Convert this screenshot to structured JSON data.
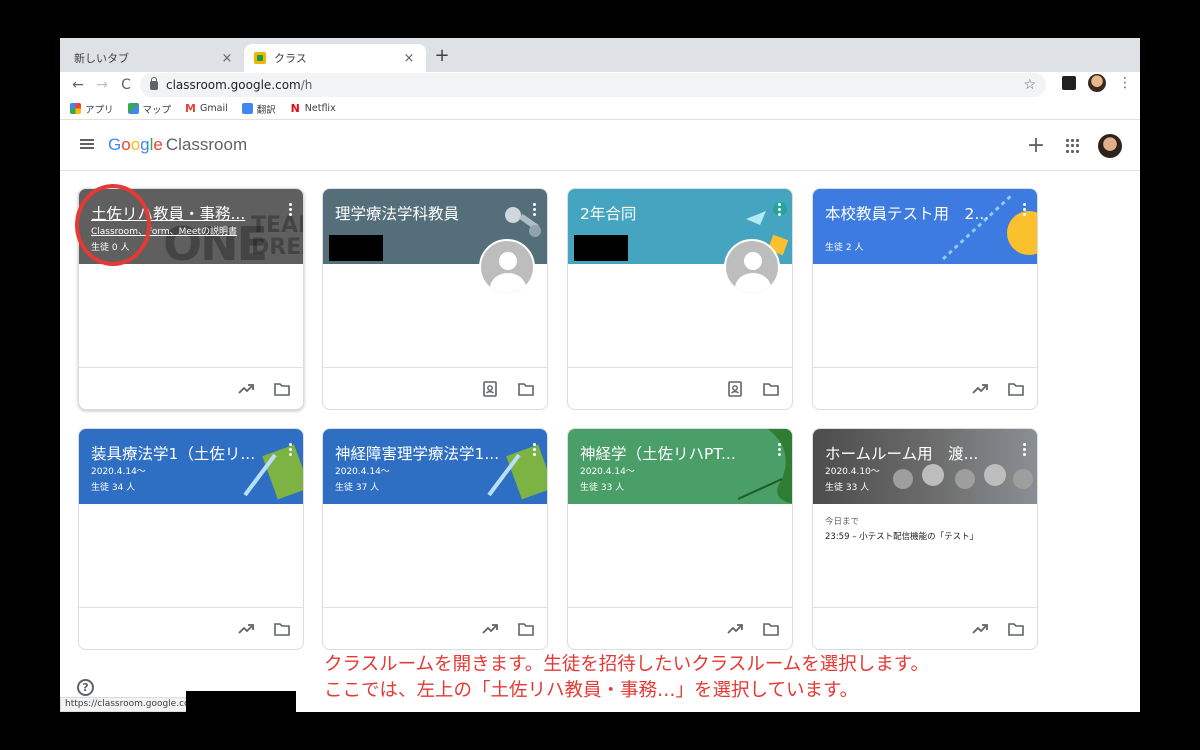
{
  "browser": {
    "tabs": [
      {
        "title": "新しいタブ",
        "close": "×"
      },
      {
        "title": "クラス",
        "close": "×"
      }
    ],
    "new_tab": "+",
    "nav": {
      "back": "←",
      "forward": "→",
      "reload": "C"
    },
    "url_host": "classroom.google.com",
    "url_path": "/h",
    "bookmark_star": "☆",
    "menu": "⋮",
    "bookmarks": [
      {
        "label": "アプリ",
        "icon": "apps-grid-icon"
      },
      {
        "label": "マップ",
        "icon": "maps-icon"
      },
      {
        "label": "Gmail",
        "icon": "gmail-icon"
      },
      {
        "label": "翻訳",
        "icon": "translate-icon"
      },
      {
        "label": "Netflix",
        "icon": "netflix-icon"
      }
    ]
  },
  "header": {
    "logo_letters": [
      "G",
      "o",
      "o",
      "g",
      "l",
      "e"
    ],
    "product": "Classroom",
    "create": "+"
  },
  "classes": [
    {
      "title": "土佐リハ教員・事務...",
      "subtitle": "Classroom、Form、Meetの説明書",
      "count": "生徒 0 人",
      "color": "#5f5f5f"
    },
    {
      "title": "理学療法学科教員",
      "color": "#546e7a"
    },
    {
      "title": "2年合同",
      "color": "#45a5c0"
    },
    {
      "title": "本校教員テスト用　2...",
      "count": "生徒 2 人",
      "color": "#3d7be0"
    },
    {
      "title": "装具療法学1（土佐リ...",
      "subtitle": "2020.4.14〜",
      "count": "生徒 34 人",
      "color": "#2e6fc4"
    },
    {
      "title": "神経障害理学療法学1...",
      "subtitle": "2020.4.14〜",
      "count": "生徒 37 人",
      "color": "#2e6fc4"
    },
    {
      "title": "神経学（土佐リハPT...",
      "subtitle": "2020.4.14〜",
      "count": "生徒 33 人",
      "color": "#4a9e68"
    },
    {
      "title": "ホームルーム用　渡...",
      "subtitle": "2020.4.10〜",
      "count": "生徒 33 人",
      "color": "#4c4c4c",
      "due_label": "今日まで",
      "due_item": "23:59 – 小テスト配信機能の「テスト」"
    }
  ],
  "banner_decor": {
    "text1": "ONE",
    "text2": "TEAM",
    "text3": "DREA"
  },
  "caption": {
    "line1": "クラスルームを開きます。生徒を招待したいクラスルームを選択します。",
    "line2": "ここでは、左上の「土佐リハ教員・事務…」を選択しています。"
  },
  "help": "?",
  "status_url": "https://classroom.google.com/",
  "accent_red": "#e53935"
}
